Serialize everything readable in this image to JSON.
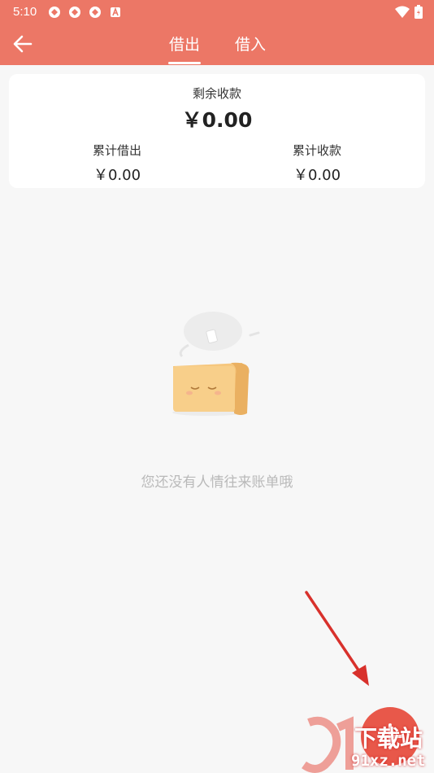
{
  "status_bar": {
    "time": "5:10",
    "icons": [
      "sync-icon",
      "sync-icon",
      "sync-icon",
      "app-a-icon"
    ],
    "right_icons": [
      "wifi-icon",
      "battery-icon"
    ]
  },
  "app_bar": {
    "back_icon": "arrow-left-icon",
    "tabs": [
      {
        "label": "借出",
        "active": true
      },
      {
        "label": "借入",
        "active": false
      }
    ]
  },
  "summary": {
    "remaining_label": "剩余收款",
    "remaining_value": "￥0.00",
    "total_lent_label": "累计借出",
    "total_lent_value": "￥0.00",
    "total_received_label": "累计收款",
    "total_received_value": "￥0.00"
  },
  "empty_state": {
    "message": "您还没有人情往来账单哦"
  },
  "watermark": {
    "line1": "下载站",
    "line2": "91xz.net"
  },
  "colors": {
    "header": "#ec7766",
    "fab": "#e8584a",
    "arrow": "#d8312c",
    "background": "#f7f7f7"
  }
}
